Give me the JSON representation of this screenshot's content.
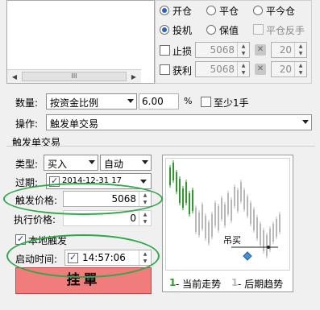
{
  "list_scroll": {
    "thumb_grip": "III"
  },
  "order_options": {
    "direction": {
      "options": [
        "开仓",
        "平仓",
        "平今仓"
      ],
      "selected": 0
    },
    "hedge": {
      "options": [
        "投机",
        "保值"
      ],
      "selected": 0
    },
    "close_reverse_label": "平仓反手",
    "stop_loss": {
      "label": "止损",
      "value": "5068",
      "qty": "20"
    },
    "take_profit": {
      "label": "获利",
      "value": "5068",
      "qty": "20"
    }
  },
  "quantity": {
    "label": "数量:",
    "mode": "按资金比例",
    "value": "6.00",
    "unit": "%",
    "min_one_label": "至少1手"
  },
  "operation": {
    "label": "操作:",
    "value": "触发单交易"
  },
  "trigger": {
    "group_title": "触发单交易",
    "type_label": "类型:",
    "type_value": "买入",
    "auto_value": "自动",
    "expire_label": "过期:",
    "expire_value": "2014-12-31 17",
    "price_label": "触发价格:",
    "price_value": "5068",
    "exec_price_label": "执行价格:",
    "exec_price_value": "0",
    "local_trigger_label": "本地触发",
    "start_time_label": "启动时间:",
    "start_time_value": "14:57:06",
    "order_button": "挂單"
  },
  "preview": {
    "buy_label": "吊买",
    "legend_current_num": "1",
    "legend_current": "- 当前走势",
    "legend_later_num": "1",
    "legend_later": "- 后期趋势",
    "colors": {
      "current": "#2e9a2e",
      "later": "#b8b8b8",
      "marker": "#4a8fd0"
    }
  }
}
